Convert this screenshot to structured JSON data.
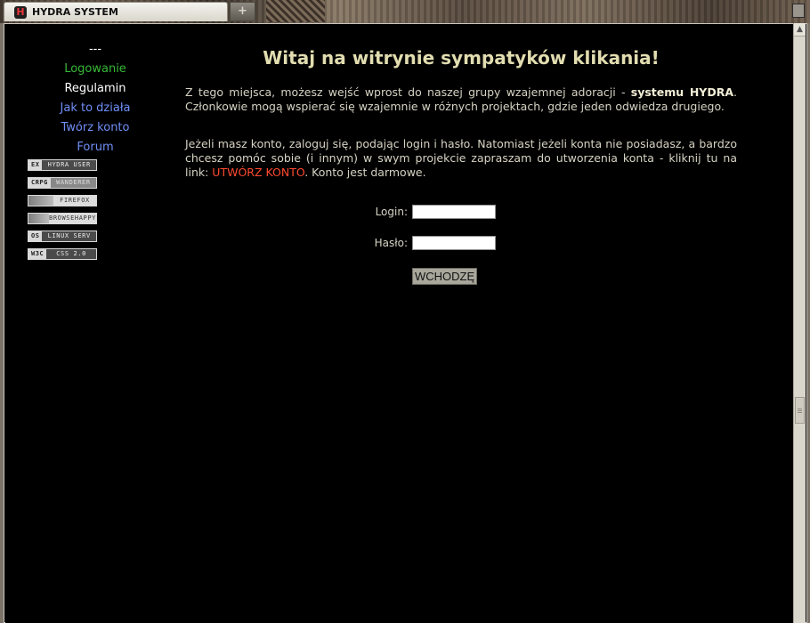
{
  "tab": {
    "logo_letter": "H",
    "title": "HYDRA SYSTEM",
    "new_tab_glyph": "+"
  },
  "icons": {
    "tab_logo": "hydra-logo-icon",
    "new_tab": "plus-icon",
    "scroll_up": "arrow-up-icon"
  },
  "sidebar": {
    "separator": "---",
    "items": [
      {
        "label": "Logowanie",
        "color": "#36b936"
      },
      {
        "label": "Regulamin",
        "color": "#ffffff"
      },
      {
        "label": "Jak to działa",
        "color": "#6f8ff6"
      },
      {
        "label": "Twórz konto",
        "color": "#6f8ff6"
      },
      {
        "label": "Forum",
        "color": "#6f8ff6"
      }
    ],
    "badges": [
      {
        "left": "EX",
        "right": "HYDRA USER"
      },
      {
        "left": "CRPG",
        "right": "WANDERER"
      },
      {
        "left": "",
        "right": "FIREFOX"
      },
      {
        "left": "",
        "right": "BROWSEHAPPY"
      },
      {
        "left": "OS",
        "right": "LINUX SERV"
      },
      {
        "left": "W3C",
        "right": "CSS 2.0"
      }
    ]
  },
  "main": {
    "title": "Witaj na witrynie sympatyków klikania!",
    "intro_before": "Z tego miejsca, możesz wejść wprost do naszej grupy wzajemnej adoracji - ",
    "intro_brand": "systemu HYDRA",
    "intro_after": ". Członkowie mogą wspierać się wzajemnie w różnych projektach, gdzie jeden odwiedza drugiego.",
    "account_before": "Jeżeli masz konto, zaloguj się, podając login i hasło. Natomiast jeżeli konta nie posiadasz, a bardzo chcesz pomóc sobie (i innym) w swym projekcie zapraszam do utworzenia konta - kliknij tu na link: ",
    "account_link": "UTWÓRZ KONTO",
    "account_after": ". Konto jest darmowe."
  },
  "login_form": {
    "login_label": "Login:",
    "login_value": "",
    "password_label": "Hasło:",
    "password_value": "",
    "submit_label": "WCHODZĘ"
  },
  "colors": {
    "background": "#000000",
    "title": "#e2ddb0",
    "body_text": "#d6d3c3",
    "link_red": "#ff4a2f",
    "link_green": "#36b936",
    "link_blue": "#6f8ff6"
  }
}
